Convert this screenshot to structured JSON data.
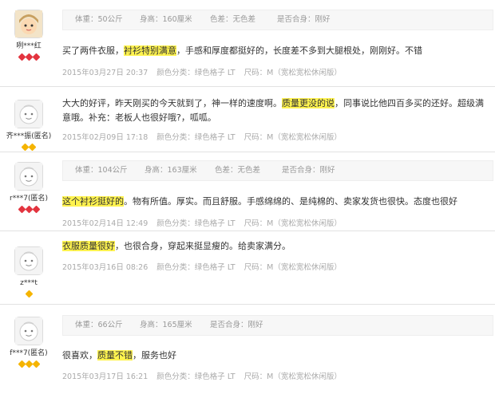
{
  "reviews": [
    {
      "user": "咧***红",
      "avatar": "custom",
      "badge_color": "#e3343f",
      "badges": 3,
      "size_info": {
        "weight": "体重：50公斤",
        "height": "身高：160厘米",
        "color_diff": "色差：无色差",
        "fit": "是否合身：刚好"
      },
      "segments": [
        {
          "text": "买了两件衣服，",
          "hl": false
        },
        {
          "text": "衬衫特别满意",
          "hl": true
        },
        {
          "text": "，手感和厚度都挺好的，长度差不多到大腿根处，刚刚好。不错",
          "hl": false
        }
      ],
      "date": "2015年03月27日 20:37",
      "color_cat": "颜色分类：绿色格子 LT",
      "size": "尺码：M（宽松宽松休闲版）"
    },
    {
      "user": "齐***振(匿名)",
      "avatar": "default",
      "badge_color": "#f5b400",
      "badges": 2,
      "size_info": null,
      "segments": [
        {
          "text": "大大的好评，昨天刚买的今天就到了，神一样的速度啊。",
          "hl": false
        },
        {
          "text": "质量更没的说",
          "hl": true
        },
        {
          "text": "，同事说比他四百多买的还好。超级满意哦。补充：老板人也很好哦?，呱呱。",
          "hl": false
        }
      ],
      "date": "2015年02月09日 17:18",
      "color_cat": "颜色分类：绿色格子 LT",
      "size": "尺码：M（宽松宽松休闲版）"
    },
    {
      "user": "r***7(匿名)",
      "avatar": "default",
      "badge_color": "#e3343f",
      "badges": 3,
      "size_info": {
        "weight": "体重：104公斤",
        "height": "身高：163厘米",
        "color_diff": "色差：无色差",
        "fit": "是否合身：刚好"
      },
      "segments": [
        {
          "text": "这个衬衫挺好的",
          "hl": true
        },
        {
          "text": "。物有所值。厚实。而且舒服。手感绵绵的、是纯棉的、卖家发货也很快。态度也很好",
          "hl": false
        }
      ],
      "date": "2015年02月14日 12:49",
      "color_cat": "颜色分类：绿色格子 LT",
      "size": "尺码：M（宽松宽松休闲版）"
    },
    {
      "user": "z***t",
      "avatar": "default",
      "badge_color": "#f5b400",
      "badges": 1,
      "size_info": null,
      "segments": [
        {
          "text": "衣服质量很好",
          "hl": true
        },
        {
          "text": "，也很合身，穿起来挺显瘦的。给卖家满分。",
          "hl": false
        }
      ],
      "date": "2015年03月16日 08:26",
      "color_cat": "颜色分类：绿色格子 LT",
      "size": "尺码：M（宽松宽松休闲版）"
    },
    {
      "user": "f***7(匿名)",
      "avatar": "default",
      "badge_color": "#f5b400",
      "badges": 3,
      "size_info": {
        "weight": "体重：66公斤",
        "height": "身高：165厘米",
        "color_diff": "",
        "fit": "是否合身：刚好"
      },
      "segments": [
        {
          "text": "很喜欢，",
          "hl": false
        },
        {
          "text": "质量不错",
          "hl": true
        },
        {
          "text": "，服务也好",
          "hl": false
        }
      ],
      "date": "2015年03月17日 16:21",
      "color_cat": "颜色分类：绿色格子 LT",
      "size": "尺码：M（宽松宽松休闲版）"
    }
  ]
}
